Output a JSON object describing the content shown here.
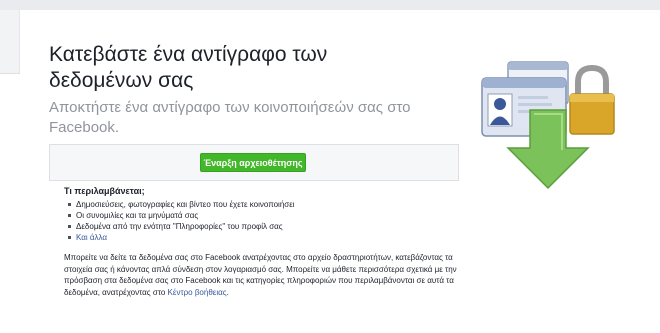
{
  "header": {
    "title": "Κατεβάστε ένα αντίγραφο των δεδομένων σας",
    "subtitle": "Αποκτήστε ένα αντίγραφο των κοινοποιήσεών σας στο Facebook."
  },
  "action": {
    "start_label": "Έναρξη αρχειοθέτησης",
    "button_color": "#42b72a"
  },
  "includes": {
    "title": "Τι περιλαμβάνεται;",
    "items": [
      "Δημοσιεύσεις, φωτογραφίες και βίντεο που έχετε κοινοποιήσει",
      "Οι συνομιλίες και τα μηνύματά σας",
      "Δεδομένα από την ενότητα \"Πληροφορίες\" του προφίλ σας"
    ],
    "more_link": "Και άλλα"
  },
  "description": {
    "text": "Μπορείτε να δείτε τα δεδομένα σας στο Facebook ανατρέχοντας στο αρχείο δραστηριοτήτων, κατεβάζοντας τα στοιχεία σας ή κάνοντας απλά σύνδεση στον λογαριασμό σας. Μπορείτε να μάθετε περισσότερα σχετικά με την πρόσβαση στα δεδομένα σας στο Facebook και τις κατηγορίες πληροφοριών που περιλαμβάνονται σε αυτά τα δεδομένα, ανατρέχοντας στο",
    "help_link": "Κέντρο βοήθειας",
    "end": "."
  },
  "illustration": {
    "icon": "download-archive-icon",
    "colors": {
      "card": "#dfe6f2",
      "lock": "#d9a62a",
      "arrow": "#7cc25b"
    }
  }
}
